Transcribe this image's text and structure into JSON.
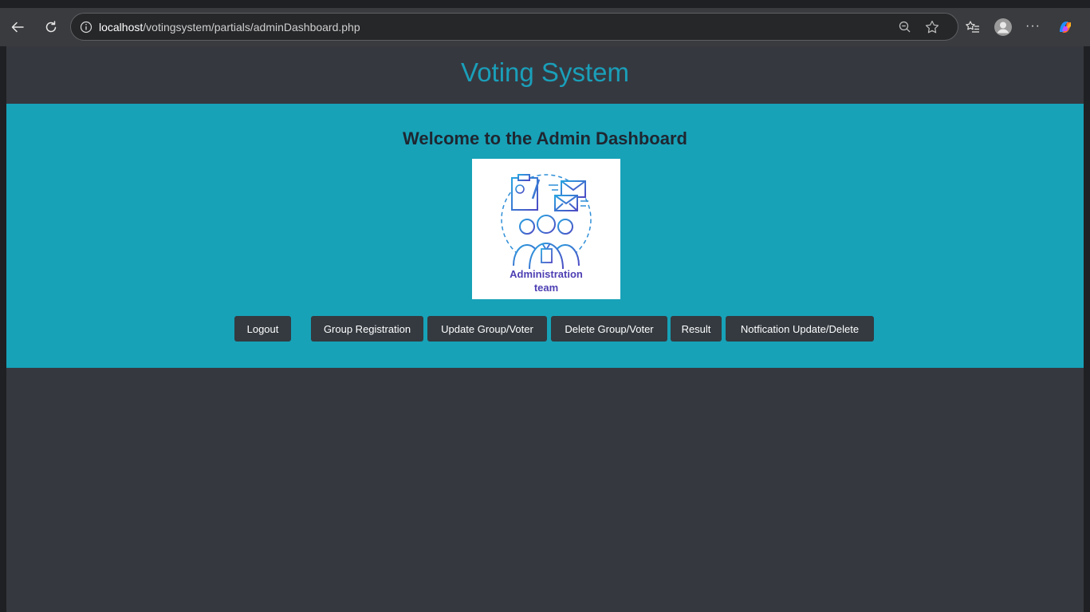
{
  "browser": {
    "url_host": "localhost",
    "url_path": "/votingsystem/partials/adminDashboard.php"
  },
  "site": {
    "title": "Voting System"
  },
  "dashboard": {
    "heading": "Welcome to the Admin Dashboard",
    "logo": {
      "caption_line1": "Administration",
      "caption_line2": "team"
    },
    "buttons": {
      "logout": "Logout",
      "group_registration": "Group Registration",
      "update_group_voter": "Update Group/Voter",
      "delete_group_voter": "Delete Group/Voter",
      "result": "Result",
      "notification": "Notfication Update/Delete"
    }
  },
  "colors": {
    "accent": "#17a2b8",
    "page_bg": "#363840",
    "button_bg": "#343a40"
  }
}
